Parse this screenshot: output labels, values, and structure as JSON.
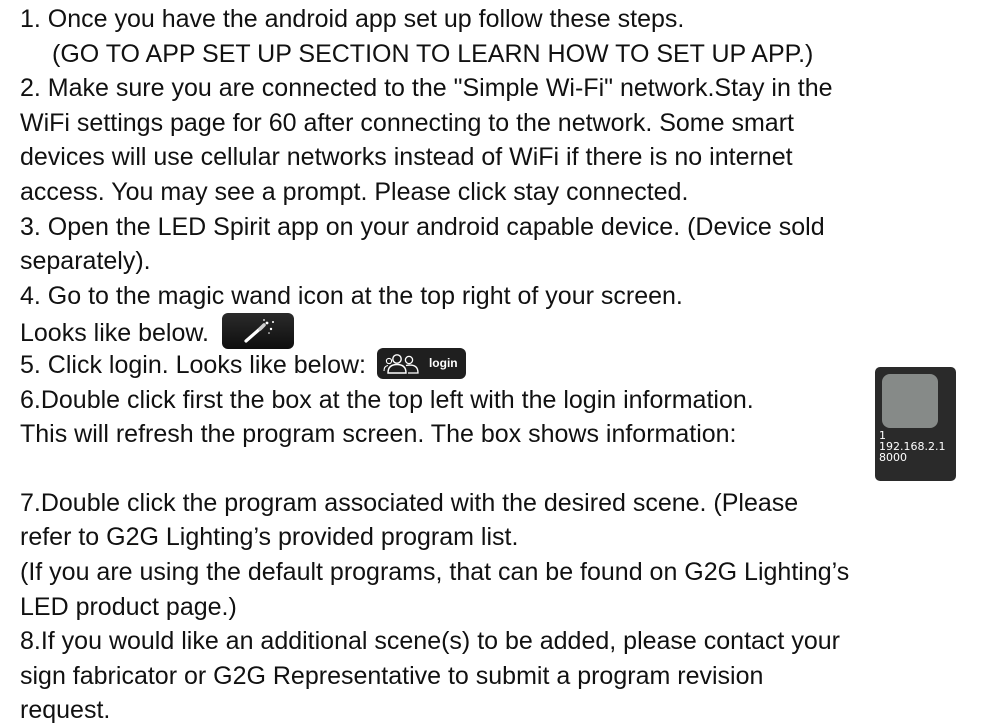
{
  "steps": {
    "s1_line1": "1. Once you have the android app set up follow these steps.",
    "s1_line2": "(GO TO APP SET UP SECTION TO LEARN HOW TO SET UP APP.)",
    "s2_line1": "2. Make sure you are connected to the \"Simple Wi-Fi\" network.Stay in the",
    "s2_line2": "WiFi settings page for 60 after connecting to the network. Some smart",
    "s2_line3": "devices will use cellular networks instead of WiFi if there is no internet",
    "s2_line4": "access. You may see a prompt. Please click stay connected.",
    "s3_line1": "3. Open the LED Spirit app on your android capable device. (Device sold",
    "s3_line2": "separately).",
    "s4_line1": "4. Go to the magic wand icon at the top right of your screen.",
    "s4_line2": "Looks like below.",
    "s5_line1": "5. Click login.  Looks like below:",
    "s6_line1": "6.Double click first the box at the top left with the login information.",
    "s6_line2": "This will refresh the program screen. The box shows information:",
    "s7_line1": "7.Double click the program associated with the desired scene. (Please",
    "s7_line2": "refer to G2G Lighting’s provided program list.",
    "s7_line3": "(If you are using the default programs, that can be found on G2G Lighting’s",
    "s7_line4": "LED product page.)",
    "s8_line1": "8.If you would like an additional scene(s) to be added, please contact your",
    "s8_line2": "sign fabricator or G2G Representative to submit a program revision",
    "s8_line3": "request."
  },
  "login_button": {
    "label": "login",
    "icon": "users-icon"
  },
  "wand_button": {
    "icon": "magic-wand-icon"
  },
  "device_box": {
    "id": "1",
    "ip": "192.168.2.1",
    "port": "8000"
  },
  "colors": {
    "text": "#111111",
    "button_bg": "#1f1f1f",
    "device_bg": "#2a2a2a",
    "device_square": "#868a88"
  }
}
